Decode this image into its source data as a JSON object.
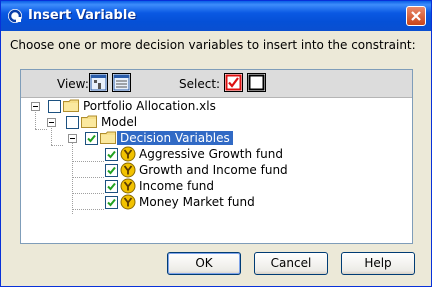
{
  "window": {
    "title": "Insert Variable"
  },
  "prompt": "Choose one or more decision variables to insert into the constraint:",
  "toolbar": {
    "view_label": "View:",
    "select_label": "Select:"
  },
  "tree": {
    "root": {
      "label": "Portfolio Allocation.xls"
    },
    "model": {
      "label": "Model"
    },
    "group": {
      "label": "Decision Variables"
    },
    "items": [
      {
        "label": "Aggressive Growth fund"
      },
      {
        "label": "Growth and Income fund"
      },
      {
        "label": "Income fund"
      },
      {
        "label": "Money Market fund"
      }
    ]
  },
  "buttons": {
    "ok": "OK",
    "cancel": "Cancel",
    "help": "Help"
  },
  "colors": {
    "title_bar": "#0a5fe6",
    "selection": "#316ac5",
    "variable_icon": "#f2c200"
  }
}
